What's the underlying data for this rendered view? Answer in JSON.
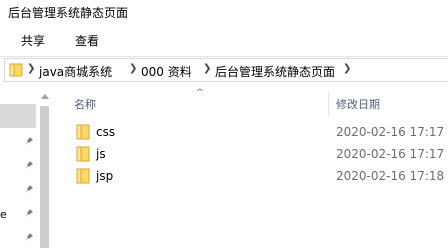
{
  "window": {
    "title": "后台管理系统静态页面"
  },
  "ribbon": {
    "tabs": [
      "共享",
      "查看"
    ]
  },
  "address_bar": {
    "segments": [
      "java商城系统",
      "000 资料",
      "后台管理系统静态页面"
    ]
  },
  "nav": {
    "fragment": "e"
  },
  "file_list": {
    "sort_indicator": "^",
    "columns": [
      "名称",
      "修改日期"
    ],
    "rows": [
      {
        "name": "css",
        "modified": "2020-02-16 17:17"
      },
      {
        "name": "js",
        "modified": "2020-02-16 17:17"
      },
      {
        "name": "jsp",
        "modified": "2020-02-16 17:18"
      }
    ]
  },
  "colors": {
    "folder_fill": "#ffd865",
    "folder_outline": "#d6a53a",
    "header_text": "#4c607a",
    "date_text": "#6d6d6d",
    "nav_selected": "#d9d9d9"
  }
}
